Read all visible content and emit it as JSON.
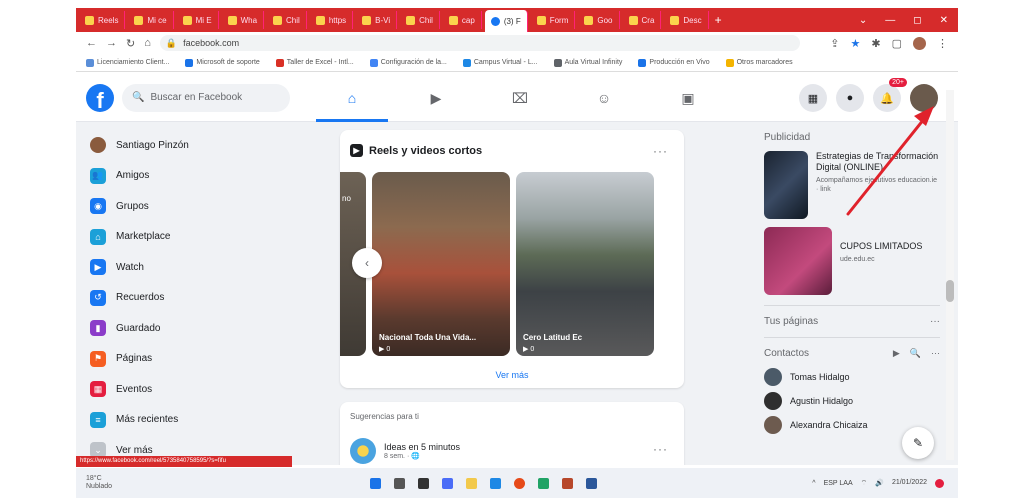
{
  "browser": {
    "tabs": [
      {
        "label": "Reels"
      },
      {
        "label": "Mi ce"
      },
      {
        "label": "Mi E"
      },
      {
        "label": "Wha"
      },
      {
        "label": "Chil"
      },
      {
        "label": "https"
      },
      {
        "label": "B-Vi"
      },
      {
        "label": "Chil"
      },
      {
        "label": "cap"
      },
      {
        "label": "(3) F",
        "active": true
      },
      {
        "label": "Form"
      },
      {
        "label": "Goo"
      },
      {
        "label": "Cra"
      },
      {
        "label": "Desc"
      }
    ],
    "new_tab": "+",
    "window_controls": [
      "⌄",
      "—",
      "◻",
      "✕"
    ],
    "url": "facebook.com",
    "bookmarks": [
      "Licenciamiento Client...",
      "Microsoft de soporte",
      "Taller de Excel - Intl...",
      "Configuración de la...",
      "Campus Virtual - L...",
      "Aula Virtual Infinity",
      "Producción en Vivo",
      "Otros marcadores"
    ]
  },
  "header": {
    "search_placeholder": "Buscar en Facebook",
    "notification_badge": "20+"
  },
  "left_menu": [
    {
      "label": "Santiago Pinzón",
      "icon": "avatar",
      "color": "#8a5b3d"
    },
    {
      "label": "Amigos",
      "icon": "friends-icon",
      "color": "#1ba0d8"
    },
    {
      "label": "Grupos",
      "icon": "groups-icon",
      "color": "#1877f2"
    },
    {
      "label": "Marketplace",
      "icon": "marketplace-icon",
      "color": "#1ba0d8"
    },
    {
      "label": "Watch",
      "icon": "watch-icon",
      "color": "#1877f2"
    },
    {
      "label": "Recuerdos",
      "icon": "memories-icon",
      "color": "#1877f2"
    },
    {
      "label": "Guardado",
      "icon": "saved-icon",
      "color": "#8b3cc9"
    },
    {
      "label": "Páginas",
      "icon": "pages-icon",
      "color": "#f55e22"
    },
    {
      "label": "Eventos",
      "icon": "events-icon",
      "color": "#e41e3f"
    },
    {
      "label": "Más recientes",
      "icon": "recent-icon",
      "color": "#1ba0d8"
    },
    {
      "label": "Ver más",
      "icon": "chevron-down-icon",
      "color": "#bec3c9"
    }
  ],
  "reels": {
    "title": "Reels y videos cortos",
    "items": [
      {
        "caption": "",
        "views": ""
      },
      {
        "caption": "Nacional Toda Una Vida...",
        "views": "▶ 0"
      },
      {
        "caption": "Cero Latitud Ec",
        "views": "▶ 0"
      }
    ],
    "partial_label": "no",
    "see_more": "Ver más"
  },
  "suggestions": {
    "title": "Sugerencias para ti",
    "item_title": "Ideas en 5 minutos",
    "item_sub": "8 sem. · 🌐"
  },
  "right": {
    "ads_title": "Publicidad",
    "ads": [
      {
        "title": "Estrategias de Transformación Digital (ONLINE)",
        "sub": "Acompañamos ejecutivos educacion.ie · link"
      },
      {
        "title": "CUPOS LIMITADOS",
        "sub": "ude.edu.ec"
      }
    ],
    "pages_title": "Tus páginas",
    "contacts_title": "Contactos",
    "contacts": [
      {
        "name": "Tomas Hidalgo",
        "color": "#4b5a68"
      },
      {
        "name": "Agustin Hidalgo",
        "color": "#2f2f2f"
      },
      {
        "name": "Alexandra Chicaiza",
        "color": "#6d5b4f"
      }
    ]
  },
  "status_url": "https://www.facebook.com/reel/5735840758595/?s=fifu",
  "taskbar": {
    "weather_temp": "18°C",
    "weather_desc": "Nublado",
    "lang": "ESP LAA",
    "time": "",
    "date": "21/01/2022"
  },
  "colors": {
    "accent": "#1877f2",
    "tabstrip": "#d62b2b",
    "arrow": "#e0222b"
  }
}
